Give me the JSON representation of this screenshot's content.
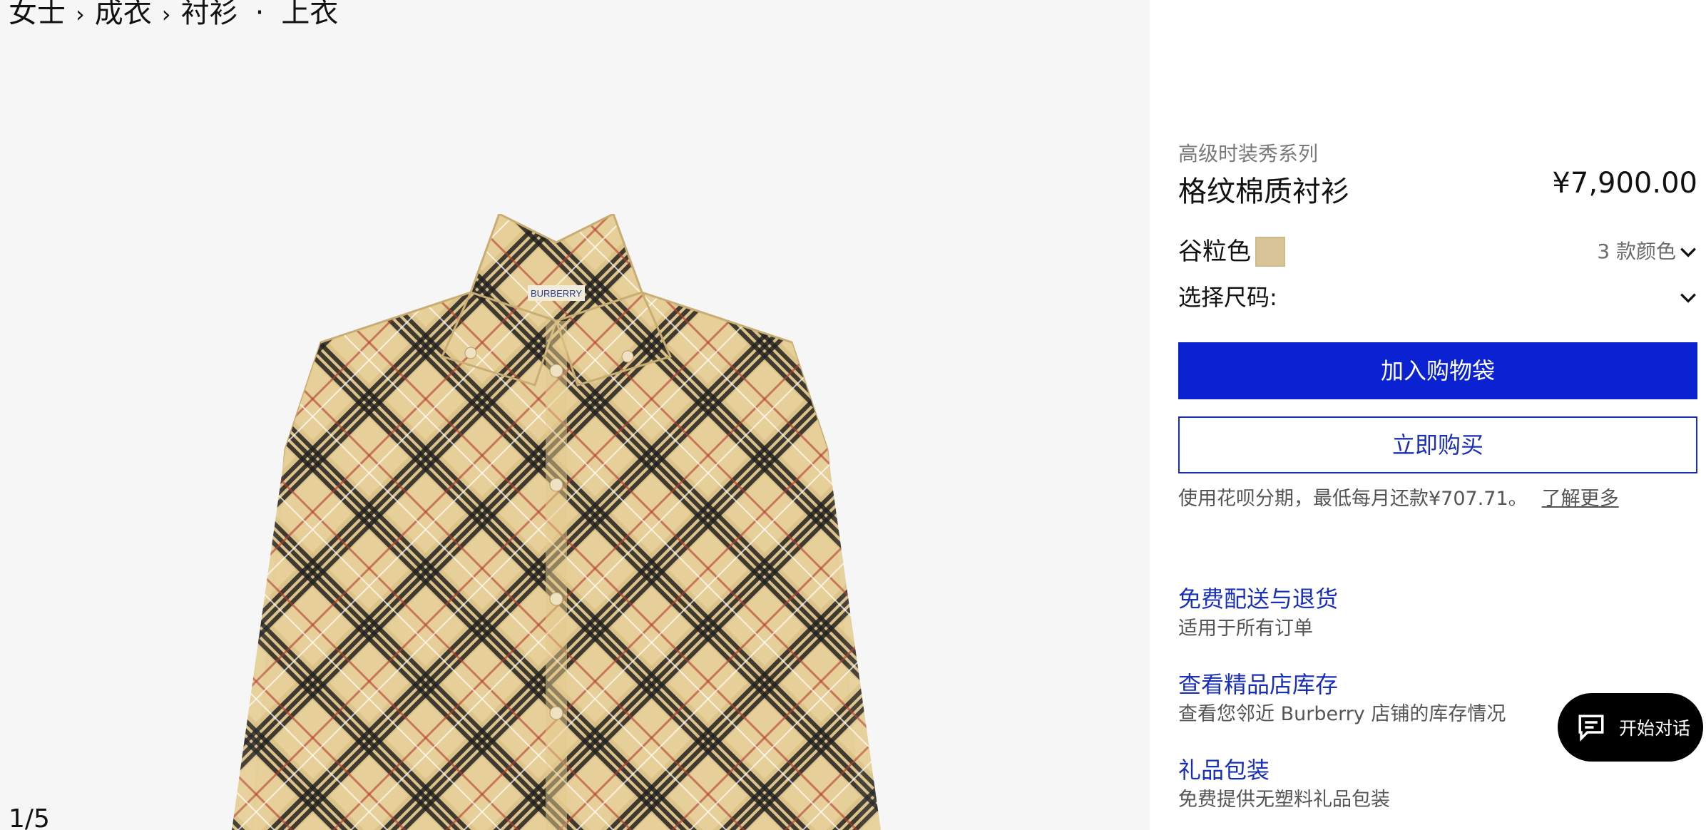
{
  "breadcrumb": {
    "items": [
      "女士",
      "成衣",
      "衬衫",
      "上衣"
    ],
    "separator": "›",
    "dot": "·"
  },
  "gallery": {
    "counter": "1/5",
    "image": "plaid-shirt-product-image",
    "embroidered_label": "BURBERRY"
  },
  "product": {
    "collection": "高级时装秀系列",
    "title": "格纹棉质衬衫",
    "price": "¥7,900.00",
    "color_name": "谷粒色",
    "swatch_color": "#d8c496",
    "colors_count": "3 款颜色",
    "size_label": "选择尺码:"
  },
  "actions": {
    "add_to_bag": "加入购物袋",
    "buy_now": "立即购买",
    "accent": "#0a22d2"
  },
  "installment": {
    "text": "使用花呗分期，最低每月还款¥707.71。",
    "link": "了解更多"
  },
  "services": [
    {
      "title": "免费配送与退货",
      "desc": "适用于所有订单"
    },
    {
      "title": "查看精品店库存",
      "desc": "查看您邻近 Burberry 店铺的库存情况"
    },
    {
      "title": "礼品包装",
      "desc": "免费提供无塑料礼品包装"
    }
  ],
  "chat": {
    "label": "开始对话",
    "icon": "chat-bubble-icon"
  }
}
